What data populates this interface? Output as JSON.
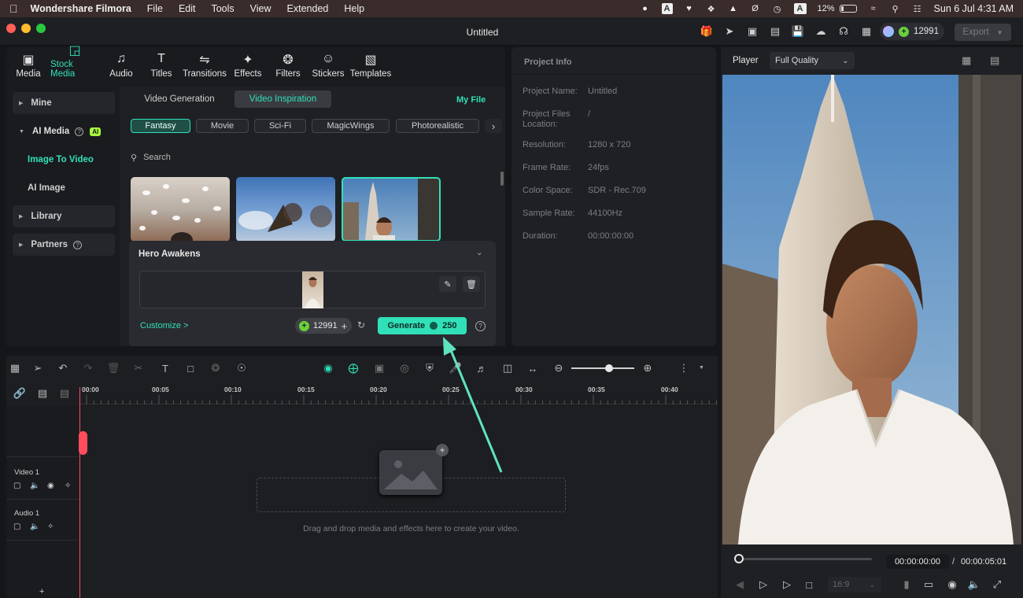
{
  "menubar": {
    "app_name": "Wondershare Filmora",
    "items": [
      "File",
      "Edit",
      "Tools",
      "View",
      "Extended",
      "Help"
    ],
    "battery": "12%",
    "datetime": "Sun 6 Jul  4:31 AM"
  },
  "window": {
    "title": "Untitled",
    "credits": "12991",
    "export_label": "Export"
  },
  "tool_tabs": [
    {
      "label": "Media",
      "icon": "media-icon"
    },
    {
      "label": "Stock Media",
      "icon": "stock-media-icon"
    },
    {
      "label": "Audio",
      "icon": "audio-icon"
    },
    {
      "label": "Titles",
      "icon": "titles-icon"
    },
    {
      "label": "Transitions",
      "icon": "transitions-icon"
    },
    {
      "label": "Effects",
      "icon": "effects-icon"
    },
    {
      "label": "Filters",
      "icon": "filters-icon"
    },
    {
      "label": "Stickers",
      "icon": "stickers-icon"
    },
    {
      "label": "Templates",
      "icon": "templates-icon"
    }
  ],
  "left_nav": {
    "mine": "Mine",
    "ai_media": "AI Media",
    "ai_badge": "AI",
    "image_to_video": "Image To Video",
    "ai_image": "AI Image",
    "library": "Library",
    "partners": "Partners"
  },
  "content": {
    "seg_video_generation": "Video Generation",
    "seg_video_inspiration": "Video Inspiration",
    "my_file": "My File",
    "chips": [
      "Fantasy",
      "Movie",
      "Sci-Fi",
      "MagicWings",
      "Photorealistic"
    ],
    "search_placeholder": "Search",
    "hero": {
      "title": "Hero Awakens",
      "customize": "Customize >",
      "credits": "12991",
      "generate_label": "Generate",
      "generate_cost": "250"
    }
  },
  "project_info": {
    "title": "Project Info",
    "rows": [
      {
        "label": "Project Name:",
        "value": "Untitled"
      },
      {
        "label": "Project Files Location:",
        "value": "/"
      },
      {
        "label": "Resolution:",
        "value": "1280 x 720"
      },
      {
        "label": "Frame Rate:",
        "value": "24fps"
      },
      {
        "label": "Color Space:",
        "value": "SDR - Rec.709"
      },
      {
        "label": "Sample Rate:",
        "value": "44100Hz"
      },
      {
        "label": "Duration:",
        "value": "00:00:00:00"
      }
    ]
  },
  "player": {
    "label": "Player",
    "quality": "Full Quality",
    "current_time": "00:00:00:00",
    "separator": "/",
    "total_time": "00:00:05:01",
    "aspect": "16:9"
  },
  "timeline": {
    "ticks": [
      "00:00",
      "00:05",
      "00:10",
      "00:15",
      "00:20",
      "00:25",
      "00:30",
      "00:35",
      "00:40"
    ],
    "tracks": [
      "Video 1",
      "Audio 1"
    ],
    "drop_hint": "Drag and drop media and effects here to create your video."
  },
  "colors": {
    "accent": "#30e0b8",
    "playhead": "#ff4d5e",
    "credit_coin": "#6ad13a"
  }
}
